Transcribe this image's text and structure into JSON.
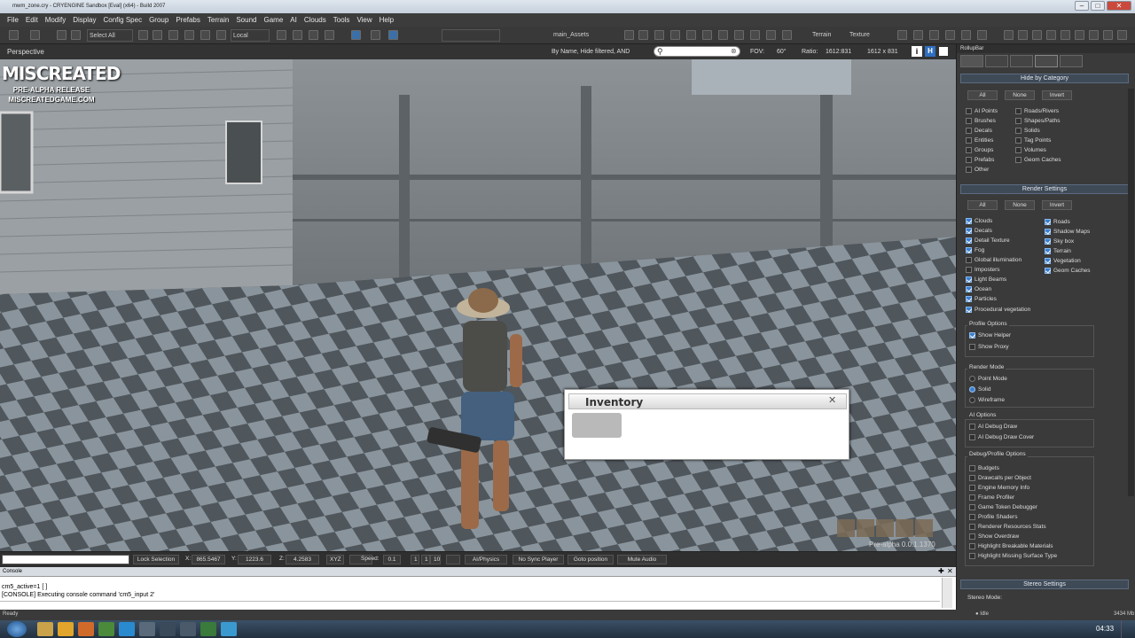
{
  "window": {
    "title": "mwm_zone.cry - CRYENGINE Sandbox [Eval] (x64) - Build 2007"
  },
  "menu": [
    "File",
    "Edit",
    "Modify",
    "Display",
    "Config Spec",
    "Group",
    "Prefabs",
    "Terrain",
    "Sound",
    "Game",
    "AI",
    "Clouds",
    "Tools",
    "View",
    "Help"
  ],
  "toolbar": {
    "select_all": "Select All",
    "coord_system": "Local",
    "layer": "main_Assets",
    "terrain": "Terrain",
    "texture": "Texture"
  },
  "viewport": {
    "label": "Perspective",
    "filter_text": "By Name, Hide filtered, AND",
    "search_placeholder": "",
    "fov_label": "FOV:",
    "fov_value": "60°",
    "ratio_label": "Ratio:",
    "ratio_value": "1612:831",
    "resolution": "1612 x 831",
    "watermark_logo": "MISCREATED",
    "watermark_sub": "PRE-ALPHA RELEASE",
    "watermark_url": "MISCREATEDGAME.COM",
    "version": "Pre-alpha 0.0.1.1370"
  },
  "inventory": {
    "title": "Inventory"
  },
  "statusbar": {
    "lock_selection": "Lock Selection",
    "x_label": "X:",
    "x_value": "865.5467",
    "y_label": "Y:",
    "y_value": "1223.6",
    "z_label": "Z:",
    "z_value": "4.2583",
    "xyz": "XYZ",
    "speed_label": "Speed:",
    "speed_value": "0.1",
    "speed_1": "1",
    "speed_10": "10",
    "ai_physics": "AI/Physics",
    "no_sync": "No Sync Player",
    "goto": "Goto position",
    "mute": "Mute Audio"
  },
  "console": {
    "title": "Console",
    "lines": [
      "cm5_active=1 [ ]",
      "[CONSOLE] Executing console command 'cm5_input 2'"
    ]
  },
  "ready": {
    "text": "Ready",
    "fps": "3434 Mb"
  },
  "rightpanel": {
    "tab_title": "RollupBar",
    "hide_by_category": {
      "title": "Hide by Category",
      "buttons": [
        "All",
        "None",
        "Invert"
      ],
      "left": [
        "AI Points",
        "Brushes",
        "Decals",
        "Entities",
        "Groups",
        "Prefabs",
        "Other"
      ],
      "right": [
        "Roads/Rivers",
        "Shapes/Paths",
        "Solids",
        "Tag Points",
        "Volumes",
        "Geom Caches"
      ]
    },
    "render_settings": {
      "title": "Render Settings",
      "buttons": [
        "All",
        "None",
        "Invert"
      ],
      "left": [
        {
          "label": "Clouds",
          "on": true
        },
        {
          "label": "Decals",
          "on": true
        },
        {
          "label": "Detail Texture",
          "on": true
        },
        {
          "label": "Fog",
          "on": true
        },
        {
          "label": "Global illumination",
          "on": false
        },
        {
          "label": "Imposters",
          "on": false
        },
        {
          "label": "Light Beams",
          "on": true
        },
        {
          "label": "Ocean",
          "on": true
        },
        {
          "label": "Particles",
          "on": true
        },
        {
          "label": "Procedural vegetation",
          "on": true
        }
      ],
      "right": [
        {
          "label": "Roads",
          "on": true
        },
        {
          "label": "Shadow Maps",
          "on": true
        },
        {
          "label": "Sky box",
          "on": true
        },
        {
          "label": "Terrain",
          "on": true
        },
        {
          "label": "Vegetation",
          "on": true
        },
        {
          "label": "Geom Caches",
          "on": true
        }
      ]
    },
    "profile_options": {
      "title": "Profile Options",
      "items": [
        {
          "label": "Show Helper",
          "on": true
        },
        {
          "label": "Show Proxy",
          "on": false
        }
      ]
    },
    "render_mode": {
      "title": "Render Mode",
      "items": [
        "Point Mode",
        "Solid",
        "Wireframe"
      ],
      "selected": "Solid"
    },
    "ai_options": {
      "title": "AI Options",
      "items": [
        "AI Debug Draw",
        "AI Debug Draw Cover"
      ]
    },
    "debug_options": {
      "title": "Debug/Profile Options",
      "items": [
        "Budgets",
        "Drawcalls per Object",
        "Engine Memory Info",
        "Frame Profiler",
        "Game Token Debugger",
        "Profile Shaders",
        "Renderer Resources Stats",
        "Show Overdraw",
        "Highlight Breakable Materials",
        "Highlight Missing Surface Type"
      ]
    },
    "stereo": {
      "title": "Stereo Settings",
      "mode_label": "Stereo Mode:"
    }
  },
  "taskbar": {
    "clock": "04:33"
  }
}
